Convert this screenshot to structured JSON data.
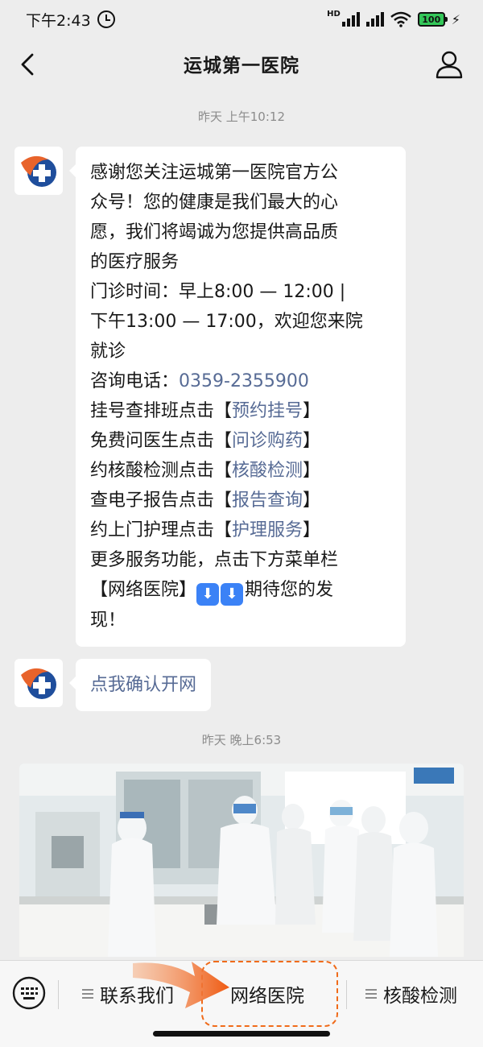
{
  "status": {
    "time": "下午2:43",
    "network": "HD",
    "battery": "100"
  },
  "header": {
    "title": "运城第一医院"
  },
  "chat": {
    "timestamp1": "昨天 上午10:12",
    "message1": {
      "lines": [
        "感谢您关注运城第一医院官方公",
        "众号！您的健康是我们最大的心",
        "愿，我们将竭诚为您提供高品质",
        "的医疗服务",
        "门诊时间：早上8:00 — 12:00 |",
        "下午13:00 — 17:00，欢迎您来院",
        "就诊"
      ],
      "phone_label": "咨询电话：",
      "phone": "0359-2355900",
      "services": [
        {
          "prefix": "挂号查排班点击【",
          "link": "预约挂号",
          "suffix": "】"
        },
        {
          "prefix": "免费问医生点击【",
          "link": "问诊购药",
          "suffix": "】"
        },
        {
          "prefix": "约核酸检测点击【",
          "link": "核酸检测",
          "suffix": "】"
        },
        {
          "prefix": "查电子报告点击【",
          "link": "报告查询",
          "suffix": "】"
        },
        {
          "prefix": "约上门护理点击【",
          "link": "护理服务",
          "suffix": "】"
        }
      ],
      "more_line1": "更多服务功能，点击下方菜单栏",
      "more_line2_a": "【网络医院】",
      "more_line2_b": "期待您的发",
      "more_line3": "现！"
    },
    "message2": {
      "link": "点我确认开网"
    },
    "timestamp2": "昨天 晚上6:53"
  },
  "menu": {
    "items": [
      "联系我们",
      "网络医院",
      "核酸检测"
    ],
    "highlighted": "网络医院"
  },
  "colors": {
    "link": "#576b95",
    "highlight": "#f06b1a",
    "background": "#ededed"
  }
}
